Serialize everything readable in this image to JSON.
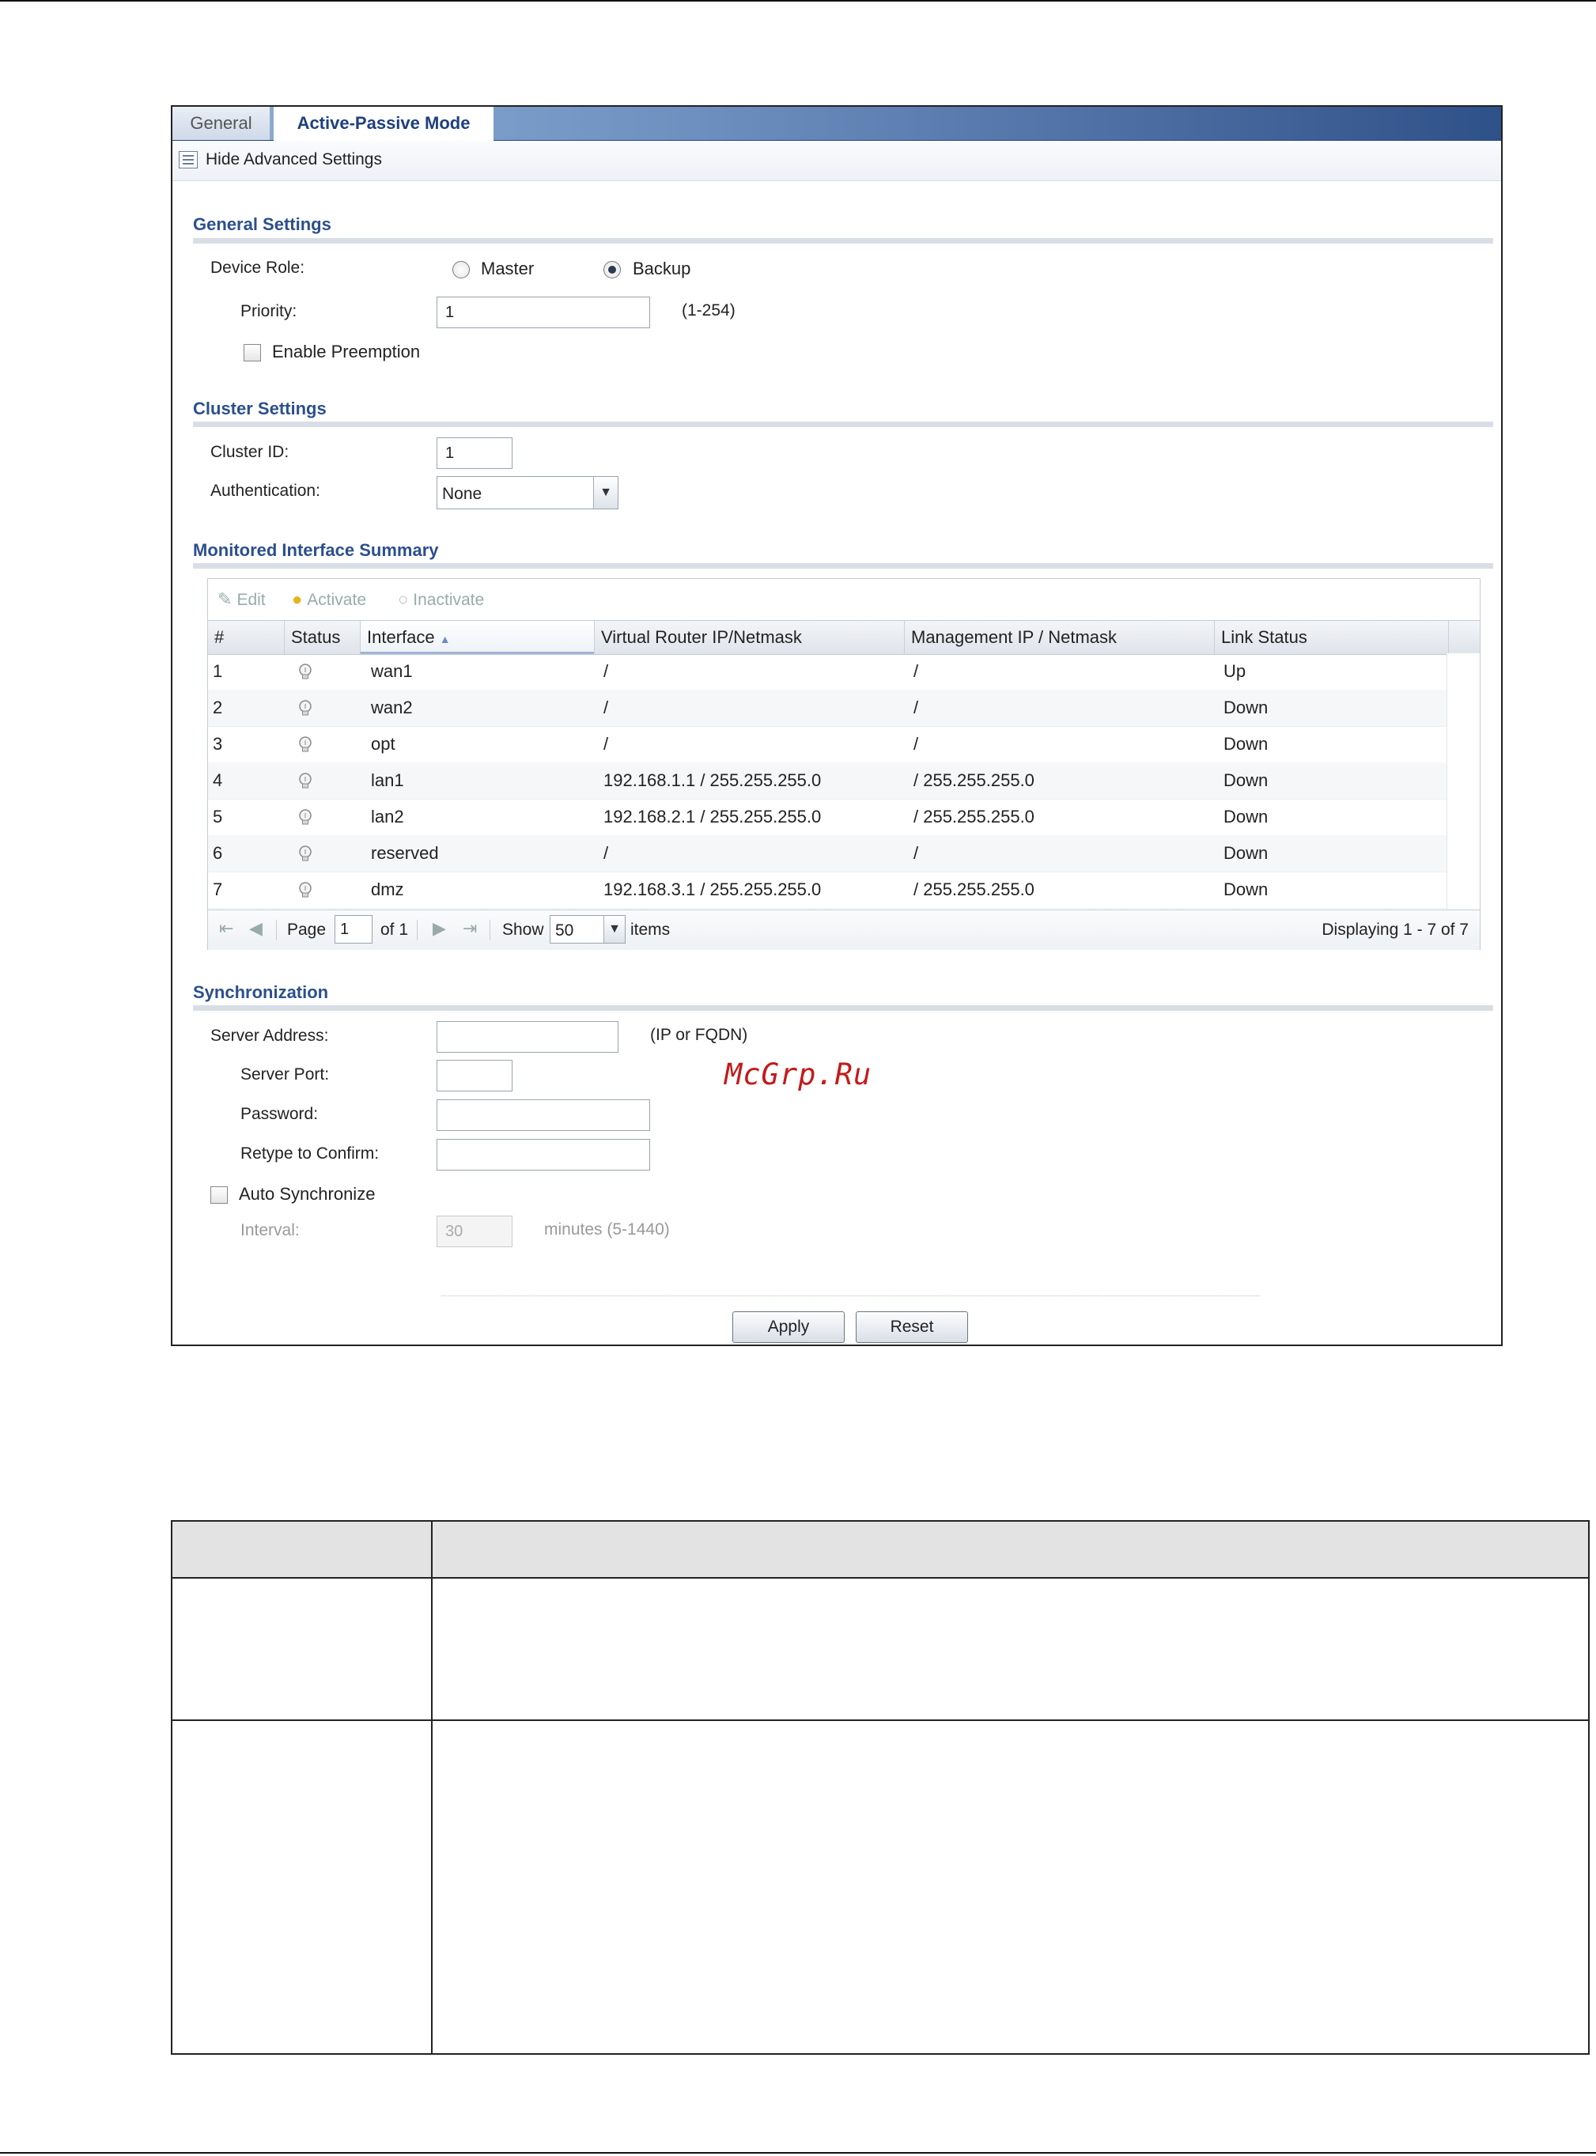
{
  "tabs": {
    "general": "General",
    "active": "Active-Passive Mode"
  },
  "advanced_toggle": "Hide Advanced Settings",
  "general_settings": {
    "title": "General Settings",
    "device_role_label": "Device Role:",
    "role_master": "Master",
    "role_backup": "Backup",
    "selected_role": "Backup",
    "priority_label": "Priority:",
    "priority_value": "1",
    "priority_hint": "(1-254)",
    "enable_preemption": "Enable Preemption"
  },
  "cluster_settings": {
    "title": "Cluster Settings",
    "cluster_id_label": "Cluster ID:",
    "cluster_id_value": "1",
    "authentication_label": "Authentication:",
    "authentication_value": "None"
  },
  "monitored": {
    "title": "Monitored Interface Summary",
    "toolbar": {
      "edit": "Edit",
      "activate": "Activate",
      "inactivate": "Inactivate"
    },
    "columns": [
      "#",
      "Status",
      "Interface",
      "Virtual Router IP/Netmask",
      "Management IP / Netmask",
      "Link Status"
    ],
    "sort_indicator": "▲",
    "rows": [
      {
        "num": "1",
        "interface": "wan1",
        "vrip": "/",
        "mgmt": "/",
        "link": "Up"
      },
      {
        "num": "2",
        "interface": "wan2",
        "vrip": "/",
        "mgmt": "/",
        "link": "Down"
      },
      {
        "num": "3",
        "interface": "opt",
        "vrip": "/",
        "mgmt": "/",
        "link": "Down"
      },
      {
        "num": "4",
        "interface": "lan1",
        "vrip": "192.168.1.1 / 255.255.255.0",
        "mgmt": "/ 255.255.255.0",
        "link": "Down"
      },
      {
        "num": "5",
        "interface": "lan2",
        "vrip": "192.168.2.1 / 255.255.255.0",
        "mgmt": "/ 255.255.255.0",
        "link": "Down"
      },
      {
        "num": "6",
        "interface": "reserved",
        "vrip": "/",
        "mgmt": "/",
        "link": "Down"
      },
      {
        "num": "7",
        "interface": "dmz",
        "vrip": "192.168.3.1 / 255.255.255.0",
        "mgmt": "/ 255.255.255.0",
        "link": "Down"
      }
    ],
    "pager": {
      "page_label": "Page",
      "page_value": "1",
      "of_label": "of 1",
      "show_label": "Show",
      "show_value": "50",
      "items_label": "items",
      "displaying": "Displaying 1 - 7 of 7"
    }
  },
  "synchronization": {
    "title": "Synchronization",
    "server_address_label": "Server Address:",
    "server_address_hint": "(IP or FQDN)",
    "server_port_label": "Server Port:",
    "password_label": "Password:",
    "retype_label": "Retype to Confirm:",
    "auto_sync_label": "Auto Synchronize",
    "interval_label": "Interval:",
    "interval_value": "30",
    "interval_hint": "minutes (5-1440)"
  },
  "buttons": {
    "apply": "Apply",
    "reset": "Reset"
  },
  "watermark": "McGrp.Ru",
  "colors": {
    "accent": "#2c4f8e",
    "watermark": "#c41a1a"
  }
}
